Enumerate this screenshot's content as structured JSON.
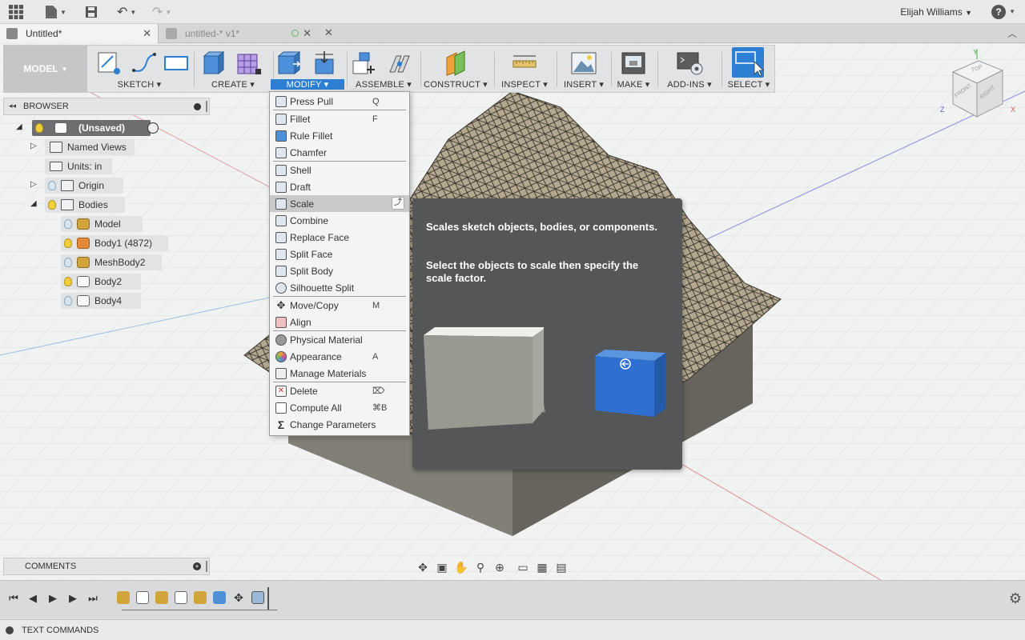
{
  "appbar": {
    "user_name": "Elijah Williams",
    "help_label": "?"
  },
  "tabs": [
    {
      "label": "Untitled*"
    },
    {
      "label": "untitled-* v1*"
    }
  ],
  "toolbar": {
    "workspace": "MODEL",
    "groups": [
      {
        "label": "SKETCH"
      },
      {
        "label": "CREATE"
      },
      {
        "label": "MODIFY"
      },
      {
        "label": "ASSEMBLE"
      },
      {
        "label": "CONSTRUCT"
      },
      {
        "label": "INSPECT"
      },
      {
        "label": "INSERT"
      },
      {
        "label": "MAKE"
      },
      {
        "label": "ADD-INS"
      },
      {
        "label": "SELECT"
      }
    ]
  },
  "browser": {
    "title": "BROWSER",
    "items": [
      {
        "label": "(Unsaved)"
      },
      {
        "label": "Named Views"
      },
      {
        "label": "Units: in"
      },
      {
        "label": "Origin"
      },
      {
        "label": "Bodies"
      },
      {
        "label": "Model"
      },
      {
        "label": "Body1 (4872)"
      },
      {
        "label": "MeshBody2"
      },
      {
        "label": "Body2"
      },
      {
        "label": "Body4"
      }
    ]
  },
  "modify_menu": {
    "items": [
      {
        "label": "Press Pull",
        "key": "Q"
      },
      {
        "label": "Fillet",
        "key": "F"
      },
      {
        "label": "Rule Fillet",
        "key": ""
      },
      {
        "label": "Chamfer",
        "key": ""
      },
      {
        "label": "Shell",
        "key": ""
      },
      {
        "label": "Draft",
        "key": ""
      },
      {
        "label": "Scale",
        "key": ""
      },
      {
        "label": "Combine",
        "key": ""
      },
      {
        "label": "Replace Face",
        "key": ""
      },
      {
        "label": "Split Face",
        "key": ""
      },
      {
        "label": "Split Body",
        "key": ""
      },
      {
        "label": "Silhouette Split",
        "key": ""
      },
      {
        "label": "Move/Copy",
        "key": "M"
      },
      {
        "label": "Align",
        "key": ""
      },
      {
        "label": "Physical Material",
        "key": ""
      },
      {
        "label": "Appearance",
        "key": "A"
      },
      {
        "label": "Manage Materials",
        "key": ""
      },
      {
        "label": "Delete",
        "key": "⌦"
      },
      {
        "label": "Compute All",
        "key": "⌘B"
      },
      {
        "label": "Change Parameters",
        "key": ""
      }
    ]
  },
  "tooltip": {
    "line1": "Scales sketch objects, bodies, or components.",
    "line2": "Select the objects to scale then specify the scale factor."
  },
  "comments": {
    "title": "COMMENTS"
  },
  "textcommands": {
    "label": "TEXT COMMANDS"
  },
  "viewcube": {
    "top": "TOP",
    "front": "FRONT",
    "right": "RIGHT",
    "axis_x": "X",
    "axis_y": "Y",
    "axis_z": "Z"
  },
  "colors": {
    "accent": "#2d7fd3",
    "mesh": "#a89c86",
    "solid": "#7d7a72",
    "tooltip_bg": "#555657"
  }
}
